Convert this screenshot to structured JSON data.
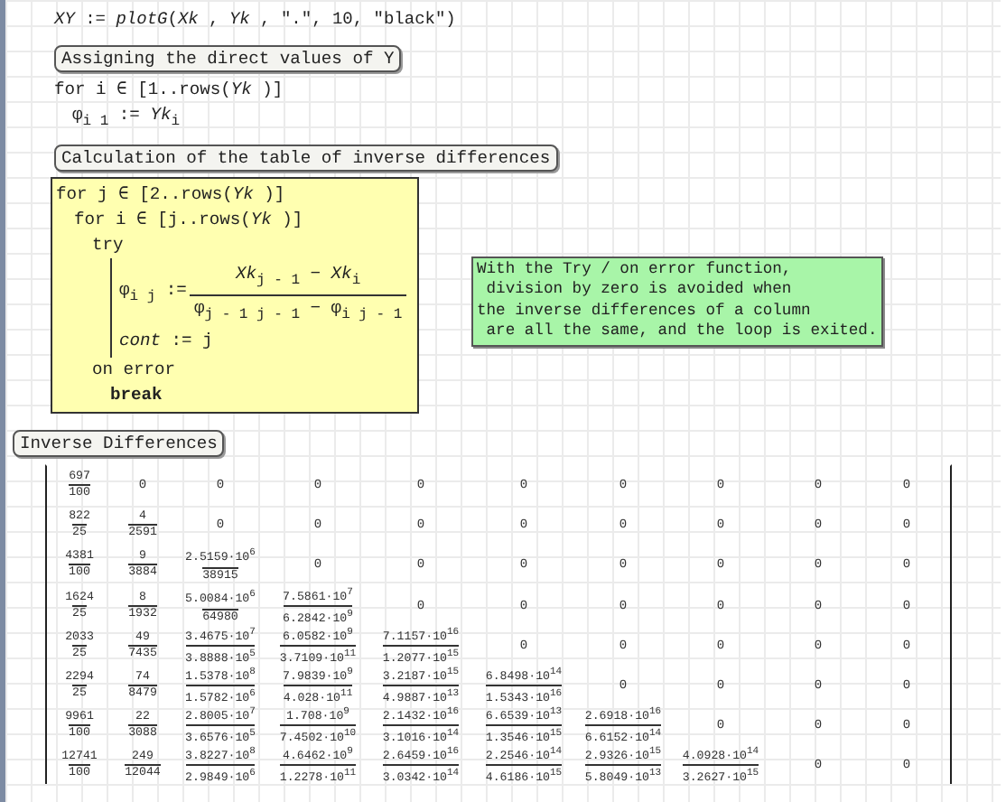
{
  "plot_statement": "*XY* := *plotG*(*Xk* , *Yk* , \".\", 10, \"black\")",
  "label_1": "Assigning the direct values of Y",
  "loop_1": {
    "head": "for  i ∈ [1..rows(*Yk* )]",
    "body": "φ$_{i 1}$ := *Yk*$_{i}$"
  },
  "label_2": "Calculation of the table of inverse differences",
  "program": {
    "kind": "loop",
    "head": "for  j ∈ [2..rows(*Yk* )]",
    "children": [
      {
        "kind": "loop",
        "head": "for  i ∈ [j..rows(*Yk* )]",
        "children": [
          {
            "kind": "try",
            "head": "try",
            "children": [
              {
                "kind": "fraction-assign",
                "lhs": "φ$_{i j}$ :=",
                "numerator": "*Xk*$_{j - 1}$ − *Xk*$_{i}$",
                "denominator": "φ$_{j - 1 j - 1}$ − φ$_{i j - 1}$"
              },
              {
                "kind": "assign",
                "text": "*cont* := j"
              }
            ],
            "handler": {
              "head": "on error",
              "children": [
                {
                  "kind": "keyword",
                  "text": "break"
                }
              ]
            }
          }
        ]
      }
    ]
  },
  "note": [
    "With the Try / on error function,",
    " division by zero is avoided when",
    "the inverse differences of a column",
    " are all the same, and the loop is exited."
  ],
  "label_3": "Inverse Differences",
  "matrix": {
    "rows": [
      [
        {
          "kind": "fraction",
          "num": "697",
          "den": "100"
        },
        {
          "kind": "number",
          "text": "0"
        },
        {
          "kind": "number",
          "text": "0"
        },
        {
          "kind": "number",
          "text": "0"
        },
        {
          "kind": "number",
          "text": "0"
        },
        {
          "kind": "number",
          "text": "0"
        },
        {
          "kind": "number",
          "text": "0"
        },
        {
          "kind": "number",
          "text": "0"
        },
        {
          "kind": "number",
          "text": "0"
        },
        {
          "kind": "number",
          "text": "0"
        }
      ],
      [
        {
          "kind": "fraction",
          "num": "822",
          "den": "25"
        },
        {
          "kind": "fraction",
          "num": "4",
          "den": "2591"
        },
        {
          "kind": "number",
          "text": "0"
        },
        {
          "kind": "number",
          "text": "0"
        },
        {
          "kind": "number",
          "text": "0"
        },
        {
          "kind": "number",
          "text": "0"
        },
        {
          "kind": "number",
          "text": "0"
        },
        {
          "kind": "number",
          "text": "0"
        },
        {
          "kind": "number",
          "text": "0"
        },
        {
          "kind": "number",
          "text": "0"
        }
      ],
      [
        {
          "kind": "fraction",
          "num": "4381",
          "den": "100"
        },
        {
          "kind": "fraction",
          "num": "9",
          "den": "3884"
        },
        {
          "kind": "fraction",
          "num": "2.5159·10$^{6}$",
          "den": "38915"
        },
        {
          "kind": "number",
          "text": "0"
        },
        {
          "kind": "number",
          "text": "0"
        },
        {
          "kind": "number",
          "text": "0"
        },
        {
          "kind": "number",
          "text": "0"
        },
        {
          "kind": "number",
          "text": "0"
        },
        {
          "kind": "number",
          "text": "0"
        },
        {
          "kind": "number",
          "text": "0"
        }
      ],
      [
        {
          "kind": "fraction",
          "num": "1624",
          "den": "25"
        },
        {
          "kind": "fraction",
          "num": "8",
          "den": "1932"
        },
        {
          "kind": "fraction",
          "num": "5.0084·10$^{6}$",
          "den": "64980"
        },
        {
          "kind": "fraction",
          "num": "7.5861·10$^{7}$",
          "den": "6.2842·10$^{9}$"
        },
        {
          "kind": "number",
          "text": "0"
        },
        {
          "kind": "number",
          "text": "0"
        },
        {
          "kind": "number",
          "text": "0"
        },
        {
          "kind": "number",
          "text": "0"
        },
        {
          "kind": "number",
          "text": "0"
        },
        {
          "kind": "number",
          "text": "0"
        }
      ],
      [
        {
          "kind": "fraction",
          "num": "2033",
          "den": "25"
        },
        {
          "kind": "fraction",
          "num": "49",
          "den": "7435"
        },
        {
          "kind": "fraction",
          "num": "3.4675·10$^{7}$",
          "den": "3.8888·10$^{5}$"
        },
        {
          "kind": "fraction",
          "num": "6.0582·10$^{9}$",
          "den": "3.7109·10$^{11}$"
        },
        {
          "kind": "fraction",
          "num": "7.1157·10$^{16}$",
          "den": "1.2077·10$^{15}$"
        },
        {
          "kind": "number",
          "text": "0"
        },
        {
          "kind": "number",
          "text": "0"
        },
        {
          "kind": "number",
          "text": "0"
        },
        {
          "kind": "number",
          "text": "0"
        },
        {
          "kind": "number",
          "text": "0"
        }
      ],
      [
        {
          "kind": "fraction",
          "num": "2294",
          "den": "25"
        },
        {
          "kind": "fraction",
          "num": "74",
          "den": "8479"
        },
        {
          "kind": "fraction",
          "num": "1.5378·10$^{8}$",
          "den": "1.5782·10$^{6}$"
        },
        {
          "kind": "fraction",
          "num": "7.9839·10$^{9}$",
          "den": "4.028·10$^{11}$"
        },
        {
          "kind": "fraction",
          "num": "3.2187·10$^{15}$",
          "den": "4.9887·10$^{13}$"
        },
        {
          "kind": "fraction",
          "num": "6.8498·10$^{14}$",
          "den": "1.5343·10$^{16}$"
        },
        {
          "kind": "number",
          "text": "0"
        },
        {
          "kind": "number",
          "text": "0"
        },
        {
          "kind": "number",
          "text": "0"
        },
        {
          "kind": "number",
          "text": "0"
        }
      ],
      [
        {
          "kind": "fraction",
          "num": "9961",
          "den": "100"
        },
        {
          "kind": "fraction",
          "num": "22",
          "den": "3088"
        },
        {
          "kind": "fraction",
          "num": "2.8005·10$^{7}$",
          "den": "3.6576·10$^{5}$"
        },
        {
          "kind": "fraction",
          "num": "1.708·10$^{9}$",
          "den": "7.4502·10$^{10}$"
        },
        {
          "kind": "fraction",
          "num": "2.1432·10$^{16}$",
          "den": "3.1016·10$^{14}$"
        },
        {
          "kind": "fraction",
          "num": "6.6539·10$^{13}$",
          "den": "1.3546·10$^{15}$"
        },
        {
          "kind": "fraction",
          "num": "2.6918·10$^{16}$",
          "den": "6.6152·10$^{14}$"
        },
        {
          "kind": "number",
          "text": "0"
        },
        {
          "kind": "number",
          "text": "0"
        },
        {
          "kind": "number",
          "text": "0"
        }
      ],
      [
        {
          "kind": "fraction",
          "num": "12741",
          "den": "100"
        },
        {
          "kind": "fraction",
          "num": "249",
          "den": "12044"
        },
        {
          "kind": "fraction",
          "num": "3.8227·10$^{8}$",
          "den": "2.9849·10$^{6}$"
        },
        {
          "kind": "fraction",
          "num": "4.6462·10$^{9}$",
          "den": "1.2278·10$^{11}$"
        },
        {
          "kind": "fraction",
          "num": "2.6459·10$^{16}$",
          "den": "3.0342·10$^{14}$"
        },
        {
          "kind": "fraction",
          "num": "2.2546·10$^{14}$",
          "den": "4.6186·10$^{15}$"
        },
        {
          "kind": "fraction",
          "num": "2.9326·10$^{15}$",
          "den": "5.8049·10$^{13}$"
        },
        {
          "kind": "fraction",
          "num": "4.0928·10$^{14}$",
          "den": "3.2627·10$^{15}$"
        },
        {
          "kind": "number",
          "text": "0"
        },
        {
          "kind": "number",
          "text": "0"
        }
      ]
    ]
  }
}
